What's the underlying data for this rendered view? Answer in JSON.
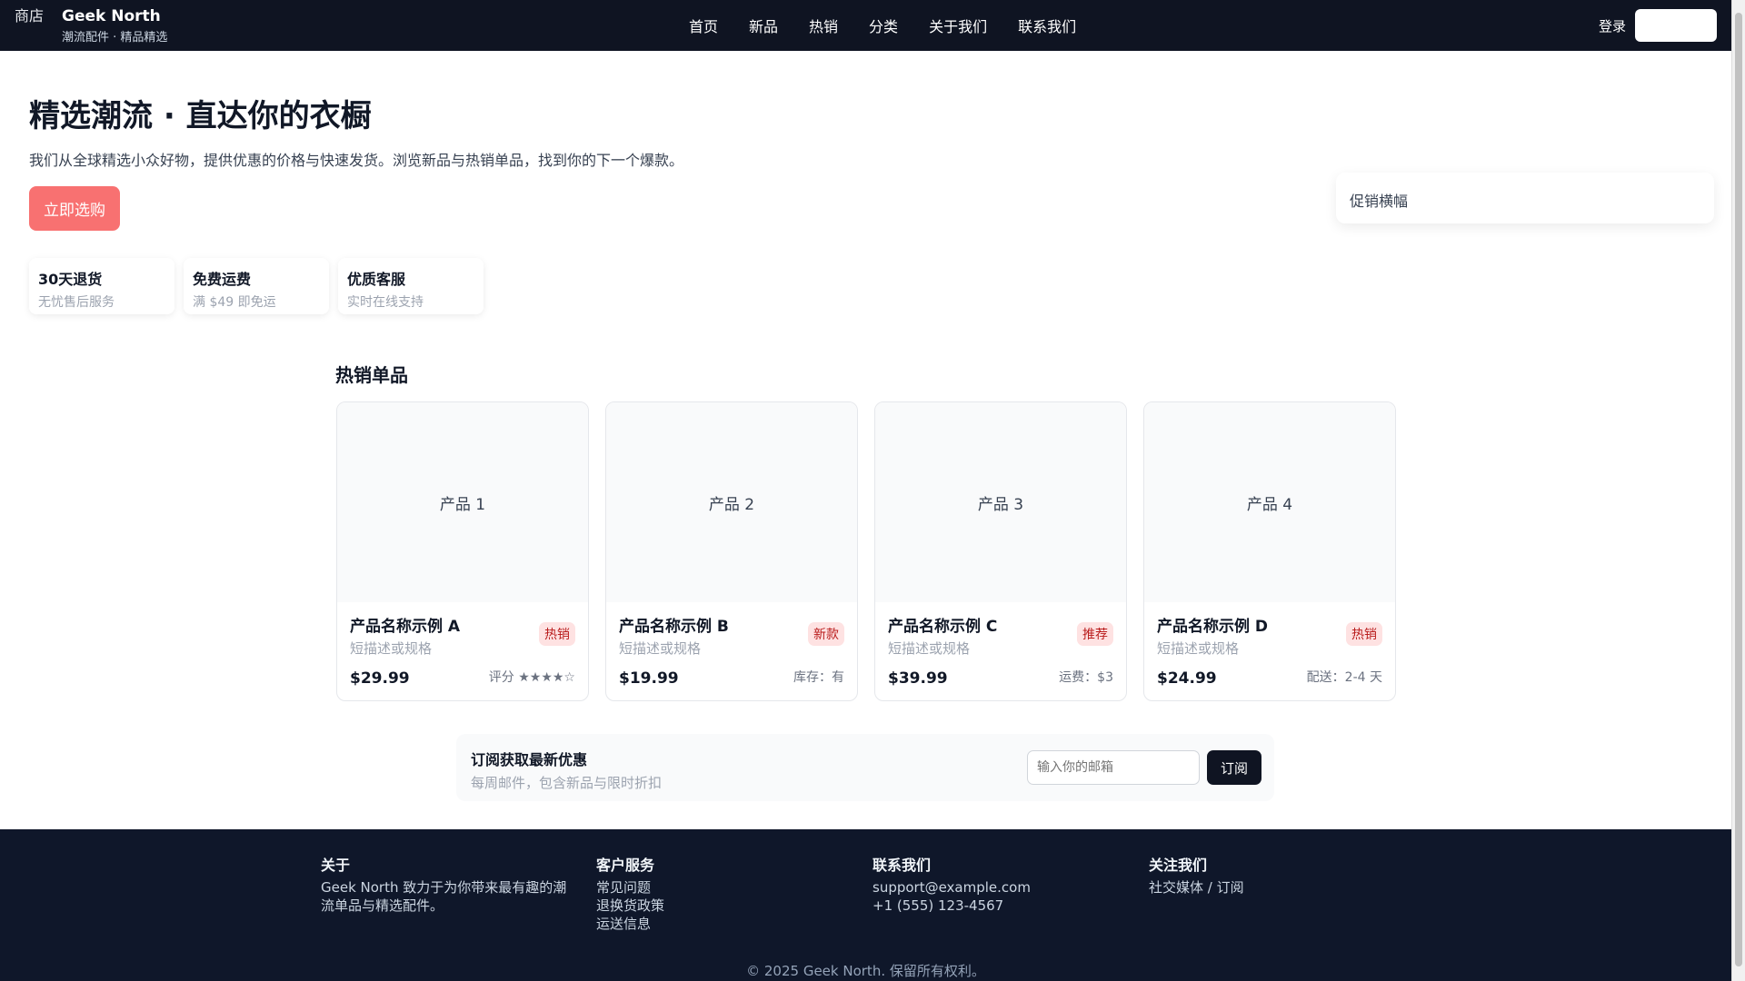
{
  "header": {
    "logo_alt": "商店",
    "brand": "Geek North",
    "tagline": "潮流配件 · 精品精选",
    "nav": [
      "首页",
      "新品",
      "热销",
      "分类",
      "关于我们",
      "联系我们"
    ],
    "login": "登录"
  },
  "hero": {
    "title": "精选潮流 · 直达你的衣橱",
    "subtitle": "我们从全球精选小众好物，提供优惠的价格与快速发货。浏览新品与热销单品，找到你的下一个爆款。",
    "cta": "立即选购",
    "promo_alt": "促销横幅",
    "features": [
      {
        "title": "30天退货",
        "desc": "无忧售后服务"
      },
      {
        "title": "免费运费",
        "desc": "满 $49 即免运"
      },
      {
        "title": "优质客服",
        "desc": "实时在线支持"
      }
    ]
  },
  "section_title": "热销单品",
  "products": [
    {
      "img_alt": "产品 1",
      "name": "产品名称示例 A",
      "desc": "短描述或规格",
      "badge": "热销",
      "price": "$29.99",
      "meta": "评分 ★★★★☆"
    },
    {
      "img_alt": "产品 2",
      "name": "产品名称示例 B",
      "desc": "短描述或规格",
      "badge": "新款",
      "price": "$19.99",
      "meta": "库存：有"
    },
    {
      "img_alt": "产品 3",
      "name": "产品名称示例 C",
      "desc": "短描述或规格",
      "badge": "推荐",
      "price": "$39.99",
      "meta": "运费：$3"
    },
    {
      "img_alt": "产品 4",
      "name": "产品名称示例 D",
      "desc": "短描述或规格",
      "badge": "热销",
      "price": "$24.99",
      "meta": "配送：2-4 天"
    }
  ],
  "subscribe": {
    "title": "订阅获取最新优惠",
    "desc": "每周邮件，包含新品与限时折扣",
    "placeholder": "输入你的邮箱",
    "button": "订阅"
  },
  "footer": {
    "about_title": "关于",
    "about_text": "Geek North 致力于为你带来最有趣的潮流单品与精选配件。",
    "service_title": "客户服务",
    "service_links": [
      "常见问题",
      "退换货政策",
      "运送信息"
    ],
    "contact_title": "联系我们",
    "email": "support@example.com",
    "phone": "+1 (555) 123-4567",
    "follow_title": "关注我们",
    "follow_text": "社交媒体 / 订阅",
    "copyright": "© 2025 Geek North. 保留所有权利。"
  }
}
